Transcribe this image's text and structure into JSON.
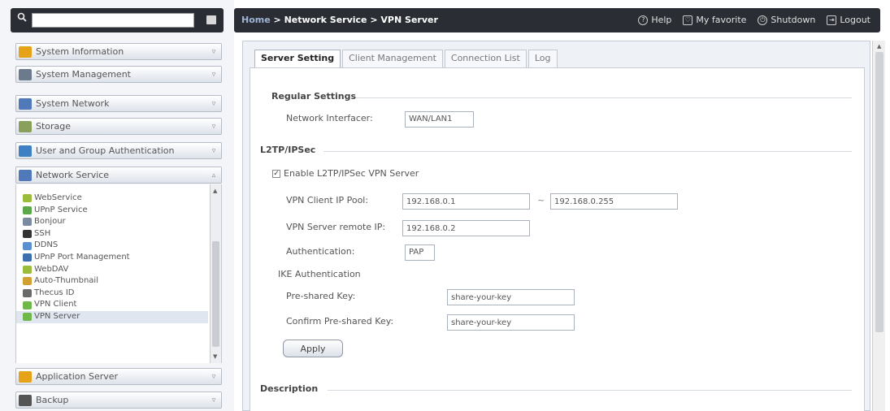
{
  "breadcrumb": {
    "home": "Home",
    "sep1": " > ",
    "section": "Network Service",
    "sep2": " > ",
    "page": "VPN Server"
  },
  "topnav": {
    "help": "Help",
    "favorite": "My favorite",
    "shutdown": "Shutdown",
    "logout": "Logout"
  },
  "sidebar": {
    "search_value": "",
    "groups": [
      {
        "label": "System Information",
        "color": "#e7a318"
      },
      {
        "label": "System Management",
        "color": "#6b7a8c"
      },
      {
        "label": "System Network",
        "color": "#4f79b8"
      },
      {
        "label": "Storage",
        "color": "#8aa05a"
      },
      {
        "label": "User and Group Authentication",
        "color": "#3f7fc4"
      },
      {
        "label": "Network Service",
        "color": "#4f79b8"
      },
      {
        "label": "Application Server",
        "color": "#e7a318"
      },
      {
        "label": "Backup",
        "color": "#555555"
      }
    ],
    "network_items": [
      {
        "label": "WebService",
        "color": "#9bbb3a"
      },
      {
        "label": "UPnP Service",
        "color": "#5aa84a"
      },
      {
        "label": "Bonjour",
        "color": "#7a8aa0"
      },
      {
        "label": "SSH",
        "color": "#333333"
      },
      {
        "label": "DDNS",
        "color": "#5a8fd0"
      },
      {
        "label": "UPnP Port Management",
        "color": "#3c6fb0"
      },
      {
        "label": "WebDAV",
        "color": "#9bbb3a"
      },
      {
        "label": "Auto-Thumbnail",
        "color": "#d2a030"
      },
      {
        "label": "Thecus ID",
        "color": "#6a6a6a"
      },
      {
        "label": "VPN Client",
        "color": "#6fb84a"
      },
      {
        "label": "VPN Server",
        "color": "#6fb84a"
      }
    ]
  },
  "tabs": [
    "Server Setting",
    "Client Management",
    "Connection List",
    "Log"
  ],
  "regular": {
    "title": "Regular Settings",
    "interface_label": "Network Interfacer:",
    "interface_value": "WAN/LAN1"
  },
  "l2tp": {
    "title": "L2TP/IPSec",
    "enable_label": "Enable L2TP/IPSec VPN Server",
    "pool_label": "VPN Client IP Pool:",
    "pool_start": "192.168.0.1",
    "pool_sep": "~",
    "pool_end": "192.168.0.255",
    "remote_label": "VPN Server remote IP:",
    "remote_value": "192.168.0.2",
    "auth_label": "Authentication:",
    "auth_value": "PAP",
    "ike_label": "IKE Authentication",
    "psk_label": "Pre-shared Key:",
    "psk_value": "share-your-key",
    "confirm_label": "Confirm Pre-shared Key:",
    "confirm_value": "share-your-key",
    "apply": "Apply"
  },
  "description": {
    "title": "Description"
  }
}
